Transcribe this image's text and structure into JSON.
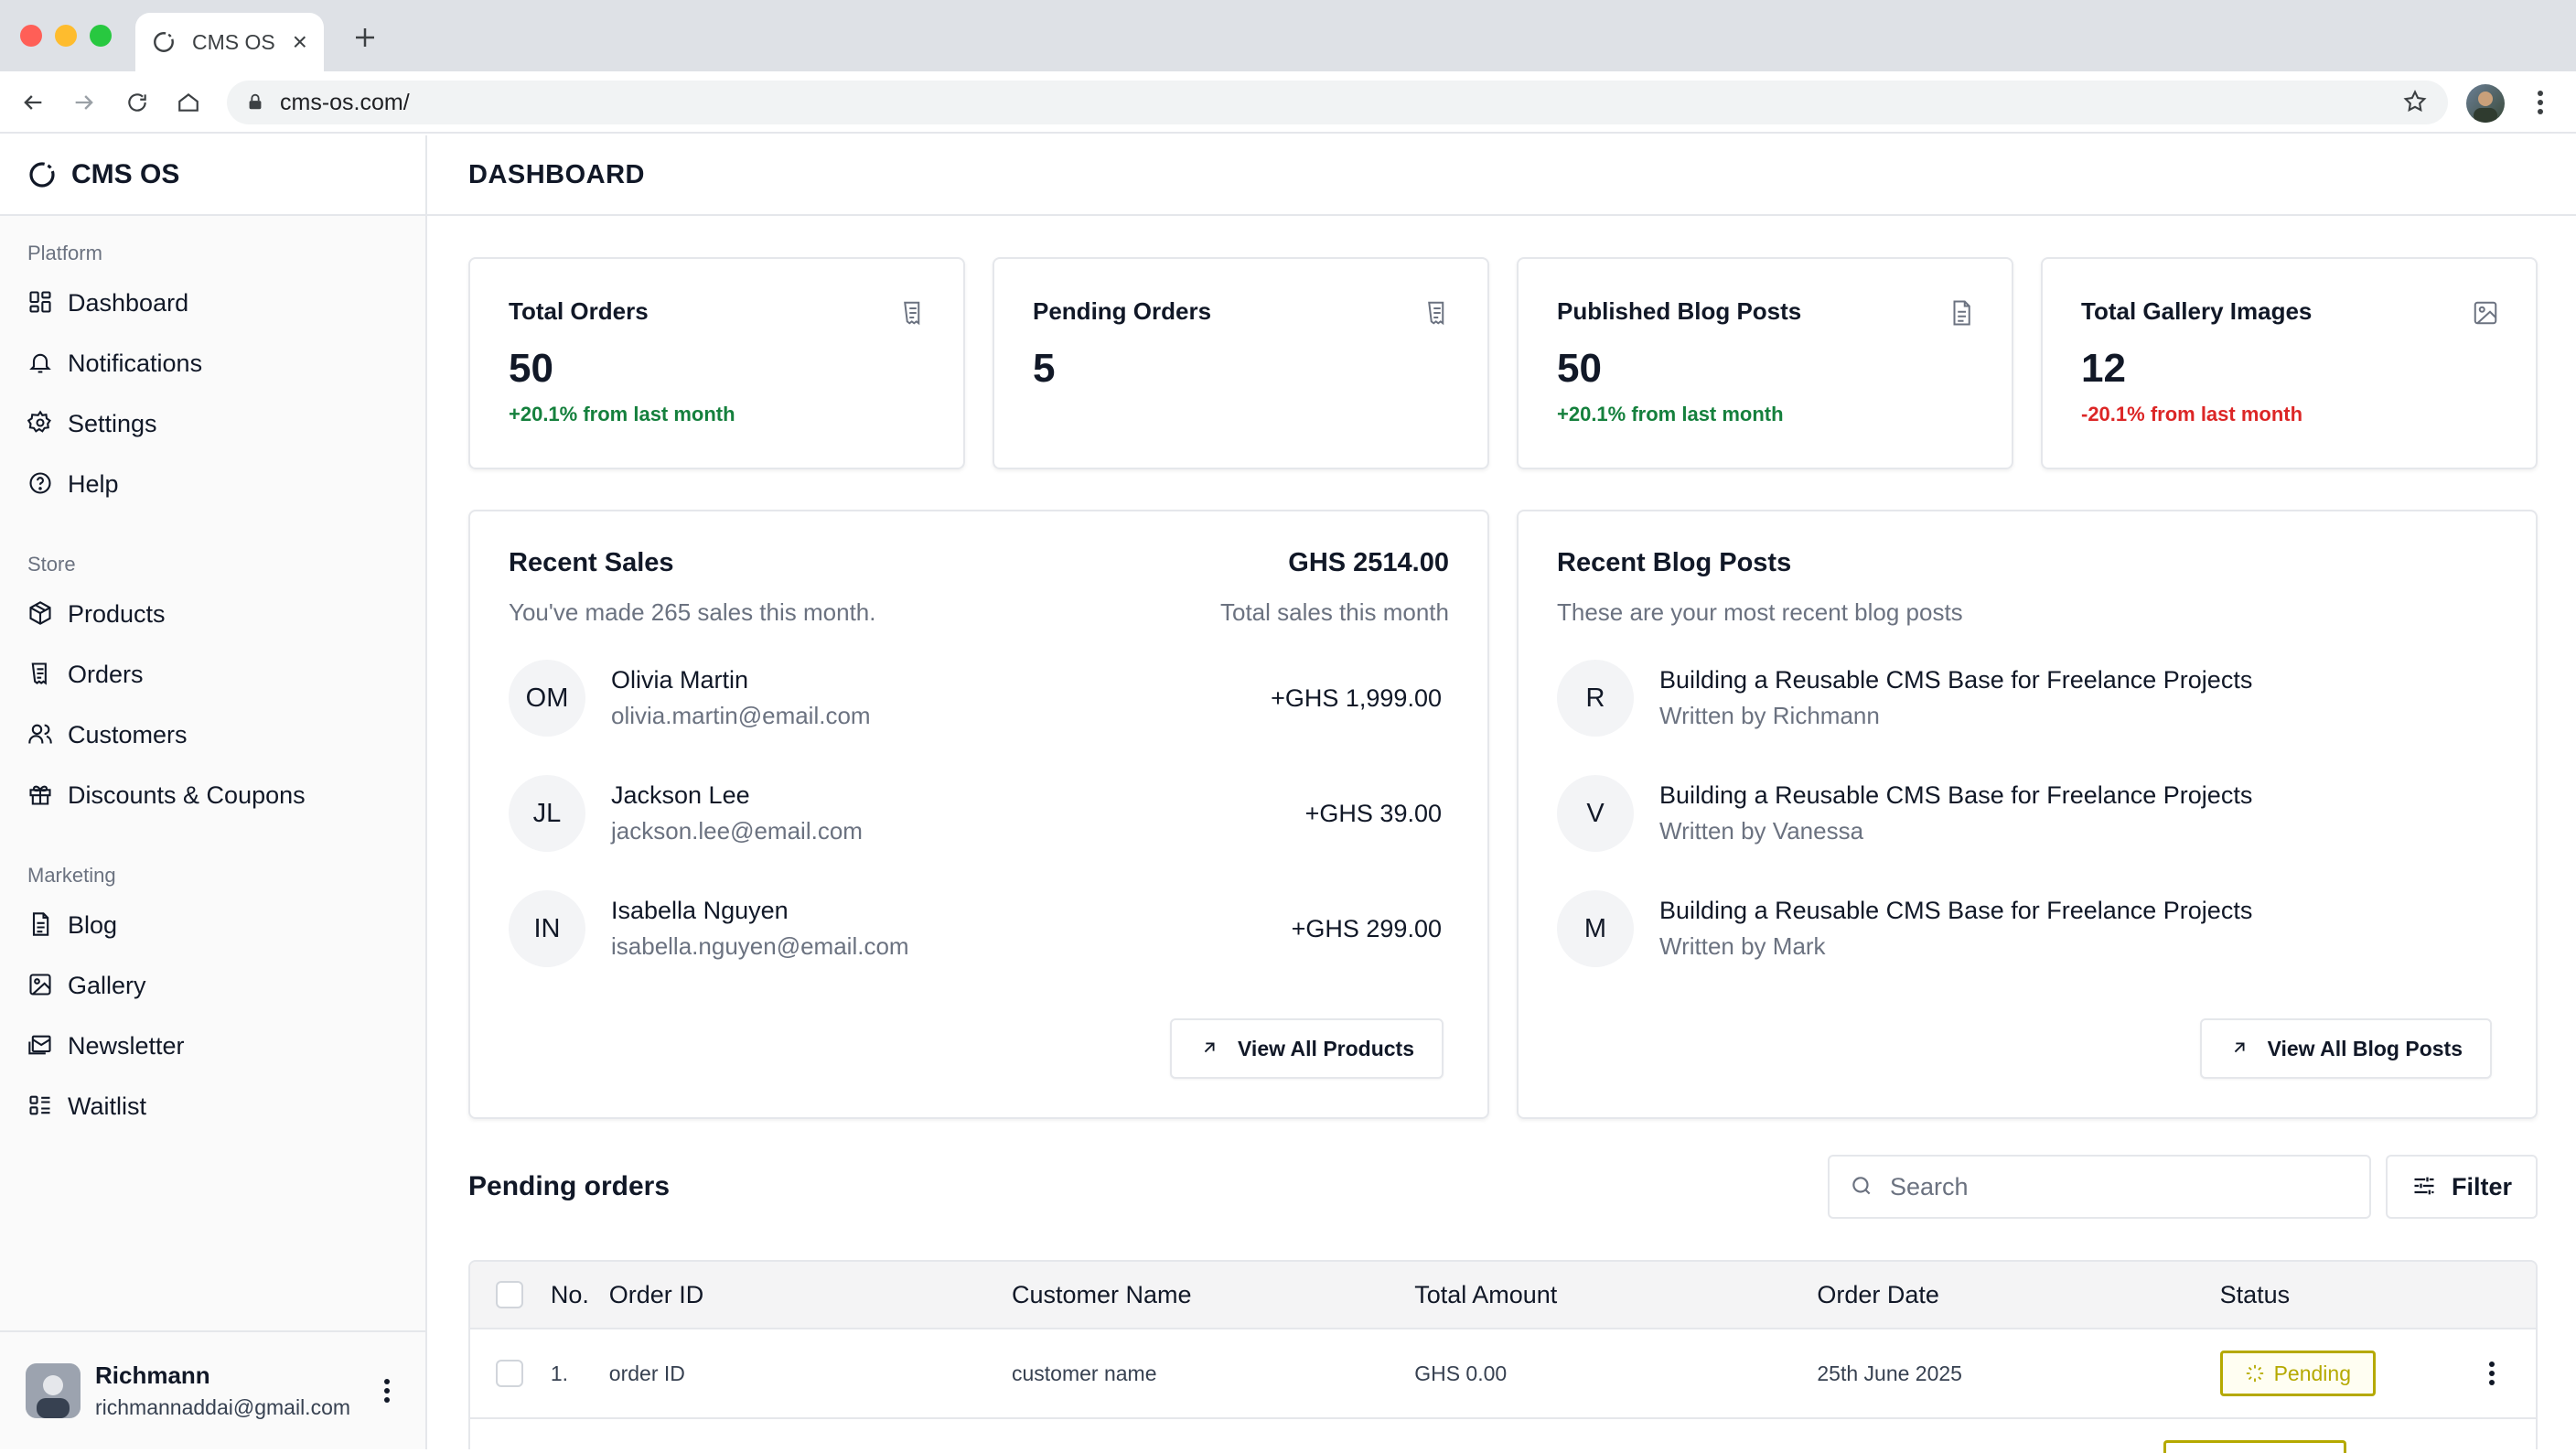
{
  "browser": {
    "tab_title": "CMS OS",
    "url": "cms-os.com/"
  },
  "brand": {
    "name": "CMS OS"
  },
  "sidebar": {
    "sections": [
      {
        "label": "Platform",
        "items": [
          {
            "label": "Dashboard",
            "icon": "dashboard-icon"
          },
          {
            "label": "Notifications",
            "icon": "bell-icon"
          },
          {
            "label": "Settings",
            "icon": "gear-icon"
          },
          {
            "label": "Help",
            "icon": "help-circle-icon"
          }
        ]
      },
      {
        "label": "Store",
        "items": [
          {
            "label": "Products",
            "icon": "package-icon"
          },
          {
            "label": "Orders",
            "icon": "receipt-icon"
          },
          {
            "label": "Customers",
            "icon": "users-icon"
          },
          {
            "label": "Discounts & Coupons",
            "icon": "gift-icon"
          }
        ]
      },
      {
        "label": "Marketing",
        "items": [
          {
            "label": "Blog",
            "icon": "document-icon"
          },
          {
            "label": "Gallery",
            "icon": "image-icon"
          },
          {
            "label": "Newsletter",
            "icon": "newsletter-icon"
          },
          {
            "label": "Waitlist",
            "icon": "list-icon"
          }
        ]
      }
    ],
    "user": {
      "name": "Richmann",
      "email": "richmannaddai@gmail.com"
    }
  },
  "header": {
    "title": "DASHBOARD"
  },
  "stats": [
    {
      "title": "Total Orders",
      "value": "50",
      "delta": "+20.1% from last month",
      "trend": "up",
      "icon": "receipt-icon"
    },
    {
      "title": "Pending Orders",
      "value": "5",
      "delta": "",
      "trend": "none",
      "icon": "receipt-icon"
    },
    {
      "title": "Published Blog Posts",
      "value": "50",
      "delta": "+20.1% from last month",
      "trend": "up",
      "icon": "document-icon"
    },
    {
      "title": "Total Gallery Images",
      "value": "12",
      "delta": "-20.1% from last month",
      "trend": "down",
      "icon": "image-icon"
    }
  ],
  "recent_sales": {
    "title": "Recent Sales",
    "subtitle": "You've made 265 sales this month.",
    "total": "GHS 2514.00",
    "total_label": "Total sales this month",
    "items": [
      {
        "initials": "OM",
        "name": "Olivia Martin",
        "email": "olivia.martin@email.com",
        "amount": "+GHS 1,999.00"
      },
      {
        "initials": "JL",
        "name": "Jackson Lee",
        "email": "jackson.lee@email.com",
        "amount": "+GHS 39.00"
      },
      {
        "initials": "IN",
        "name": "Isabella Nguyen",
        "email": "isabella.nguyen@email.com",
        "amount": "+GHS 299.00"
      }
    ],
    "button_label": "View All Products"
  },
  "recent_posts": {
    "title": "Recent Blog Posts",
    "subtitle": "These are your most recent blog posts",
    "items": [
      {
        "initials": "R",
        "title": "Building a Reusable CMS Base for Freelance Projects",
        "author": "Written by Richmann"
      },
      {
        "initials": "V",
        "title": "Building a Reusable CMS Base for Freelance Projects",
        "author": "Written by Vanessa"
      },
      {
        "initials": "M",
        "title": "Building a Reusable CMS Base for Freelance Projects",
        "author": "Written by Mark"
      }
    ],
    "button_label": "View All Blog Posts"
  },
  "pending_orders": {
    "title": "Pending orders",
    "search_placeholder": "Search",
    "filter_label": "Filter",
    "columns": [
      "No.",
      "Order ID",
      "Customer Name",
      "Total Amount",
      "Order Date",
      "Status"
    ],
    "rows": [
      {
        "no": "1.",
        "order_id": "order ID",
        "customer": "customer name",
        "amount": "GHS 0.00",
        "date": "25th June 2025",
        "status": "Pending"
      }
    ]
  },
  "colors": {
    "positive": "#15803d",
    "negative": "#dc2626",
    "pending": "#b5a900"
  }
}
